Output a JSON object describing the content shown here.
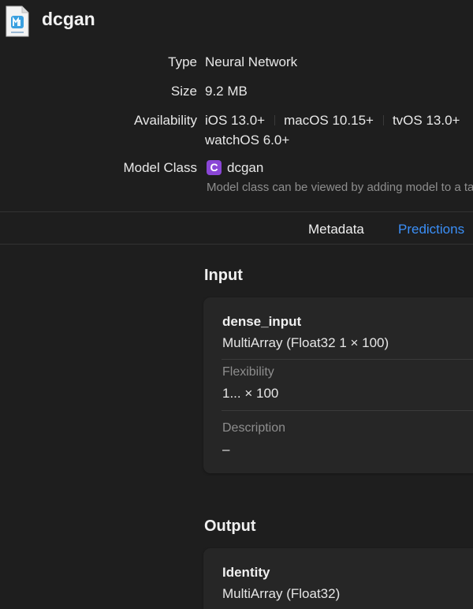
{
  "header": {
    "title": "dcgan",
    "file_icon": "mlmodel-file-icon"
  },
  "info": {
    "type_label": "Type",
    "type_value": "Neural Network",
    "size_label": "Size",
    "size_value": "9.2 MB",
    "availability_label": "Availability",
    "availability": [
      "iOS 13.0+",
      "macOS 10.15+",
      "tvOS 13.0+",
      "watchOS 6.0+"
    ],
    "model_class_label": "Model Class",
    "model_class_badge": "C",
    "model_class_value": "dcgan",
    "model_class_note": "Model class can be viewed by adding model to a target"
  },
  "tabs": {
    "metadata": "Metadata",
    "predictions": "Predictions"
  },
  "input": {
    "section_title": "Input",
    "name": "dense_input",
    "type": "MultiArray (Float32 1 × 100)",
    "flexibility_label": "Flexibility",
    "flexibility_value": "1... × 100",
    "description_label": "Description",
    "description_value": "–"
  },
  "output": {
    "section_title": "Output",
    "name": "Identity",
    "type": "MultiArray (Float32)"
  },
  "colors": {
    "background": "#1e1e1e",
    "card": "#262626",
    "accent": "#3b8ff7",
    "class_badge": "#8a46d6"
  }
}
